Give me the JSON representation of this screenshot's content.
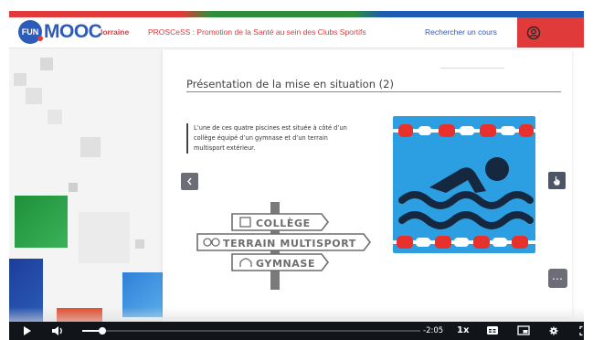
{
  "header": {
    "logo_badge": "FUN",
    "logo_word": "MOOC",
    "course_org": "lorraine",
    "course_title": "PROSCeSS : Promotion de la Santé au sein des Clubs Sportifs",
    "search_link": "Rechercher un cours",
    "user_icon": "user-circle-icon"
  },
  "slide": {
    "title": "Présentation de la mise en situation (2)",
    "body": "L’une de ces quatre piscines est située à côté d’un collège équipé d’un gymnase et d’un terrain multisport extérieur.",
    "prev_icon": "chevron-left-icon",
    "next_icon": "cursor-hand-icon",
    "more_icon": "more-dots-icon",
    "image_icon": "swimmer-icon",
    "signs": [
      "COLLÈGE",
      "TERRAIN MULTISPORT",
      "GYMNASE"
    ]
  },
  "player": {
    "time_remaining": "-2:05",
    "speed": "1x",
    "progress": 0.06,
    "icons": [
      "play-icon",
      "volume-icon",
      "captions-icon",
      "pip-icon",
      "settings-icon",
      "fullscreen-icon"
    ]
  },
  "colors": {
    "brand_blue": "#2c5bb8",
    "brand_red": "#e03a3a",
    "pool_blue": "#2c9ee2",
    "control_bar": "#111418"
  }
}
